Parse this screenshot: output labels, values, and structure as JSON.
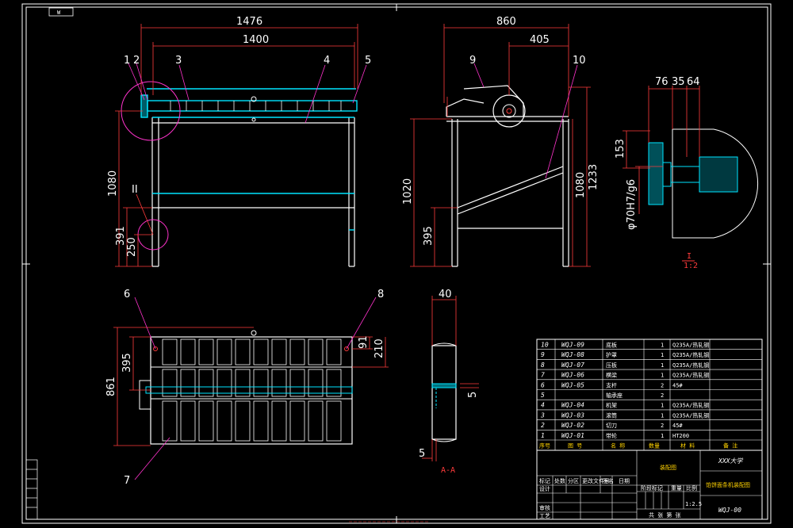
{
  "drawing": {
    "tag_top_left": "W",
    "front_view": {
      "dim_overall_width": "1476",
      "dim_inner_width": "1400",
      "dim_height": "1080",
      "dim_shelf": "391",
      "dim_low": "250",
      "detail_mark": "II",
      "balloons": [
        "1",
        "2",
        "3",
        "4",
        "5"
      ]
    },
    "side_view": {
      "dim_width": "860",
      "dim_half": "405",
      "dim_height_left": "1020",
      "dim_low": "395",
      "dim_height_right": "1080",
      "dim_total": "1233",
      "balloons": [
        "9",
        "10"
      ]
    },
    "detail_view": {
      "dims": [
        "76",
        "35",
        "64"
      ],
      "dim_153": "153",
      "fit": "φ70H7/g6",
      "label_roman": "I",
      "label_scale": "1:2"
    },
    "top_view": {
      "dim_861": "861",
      "dim_395": "395",
      "dim_91": "91",
      "dim_210": "210",
      "balloons": [
        "6",
        "7",
        "8"
      ]
    },
    "section_view": {
      "dim_40": "40",
      "dim_5a": "5",
      "dim_5b": "5",
      "label": "A-A"
    }
  },
  "parts_list": {
    "rows": [
      {
        "no": "10",
        "code": "WQJ-09",
        "name": "底板",
        "qty": "1",
        "material": "Q235A/热轧钢"
      },
      {
        "no": "9",
        "code": "WQJ-08",
        "name": "护罩",
        "qty": "1",
        "material": "Q235A/热轧钢"
      },
      {
        "no": "8",
        "code": "WQJ-07",
        "name": "压板",
        "qty": "1",
        "material": "Q235A/热轧钢"
      },
      {
        "no": "7",
        "code": "WQJ-06",
        "name": "横梁",
        "qty": "1",
        "material": "Q235A/热轧钢"
      },
      {
        "no": "6",
        "code": "WQJ-05",
        "name": "支杆",
        "qty": "2",
        "material": "45#"
      },
      {
        "no": "5",
        "code": "",
        "name": "轴承座",
        "qty": "2",
        "material": ""
      },
      {
        "no": "4",
        "code": "WQJ-04",
        "name": "机架",
        "qty": "1",
        "material": "Q235A/热轧钢"
      },
      {
        "no": "3",
        "code": "WQJ-03",
        "name": "滚筒",
        "qty": "1",
        "material": "Q235A/热轧钢"
      },
      {
        "no": "2",
        "code": "WQJ-02",
        "name": "切刀",
        "qty": "2",
        "material": "45#"
      },
      {
        "no": "1",
        "code": "WQJ-01",
        "name": "带轮",
        "qty": "1",
        "material": "HT200"
      }
    ],
    "header": {
      "no": "序号",
      "code": "图  号",
      "name": "名  称",
      "qty": "数量",
      "material": "材  料",
      "remark": "备  注"
    }
  },
  "title_block": {
    "university": "XXX大学",
    "drawing_title": "装配图",
    "subtitle": "馅饼面条机装配图",
    "drawing_number": "WQJ-00",
    "scale": "1:2.5",
    "row_labels": [
      "设计",
      "审核",
      "工艺"
    ],
    "col_labels": [
      "标记",
      "处数",
      "分区",
      "更改文件号",
      "签名",
      "日期"
    ],
    "stage_labels": [
      "阶段标记",
      "重量",
      "比例"
    ],
    "sheet_label": "共  张  第  张"
  },
  "colors": {
    "background": "#000000",
    "frame": "#ffffff",
    "dimension": "#ff3b3b",
    "structure": "#ffffff",
    "cyan": "#00e5ff",
    "magenta": "#ff33cc"
  }
}
